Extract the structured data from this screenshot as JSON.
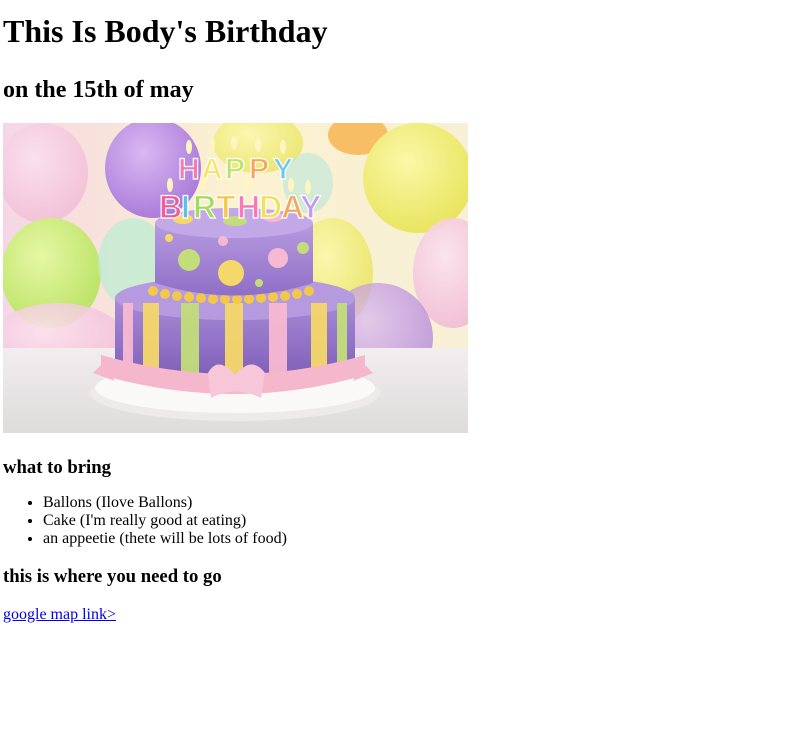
{
  "header": {
    "title": "This Is Body's Birthday",
    "subtitle": "on the 15th of may"
  },
  "hero_image": {
    "candle_letters": [
      "H",
      "A",
      "P",
      "P",
      "Y",
      "B",
      "I",
      "R",
      "T",
      "H",
      "D",
      "A",
      "Y"
    ],
    "colors": {
      "frosting_top": "#a88ad6",
      "frosting_bottom": "#9d7fd0",
      "ribbon": "#f4b7cc",
      "board": "#f3f1f0"
    }
  },
  "bring_section": {
    "heading": "what to bring",
    "items": [
      "Ballons (Ilove Ballons)",
      "Cake (I'm really good at eating)",
      "an appeetie (thete will be lots of food)"
    ]
  },
  "location_section": {
    "heading": "this is where you need to go",
    "link_text": "google map link>"
  }
}
